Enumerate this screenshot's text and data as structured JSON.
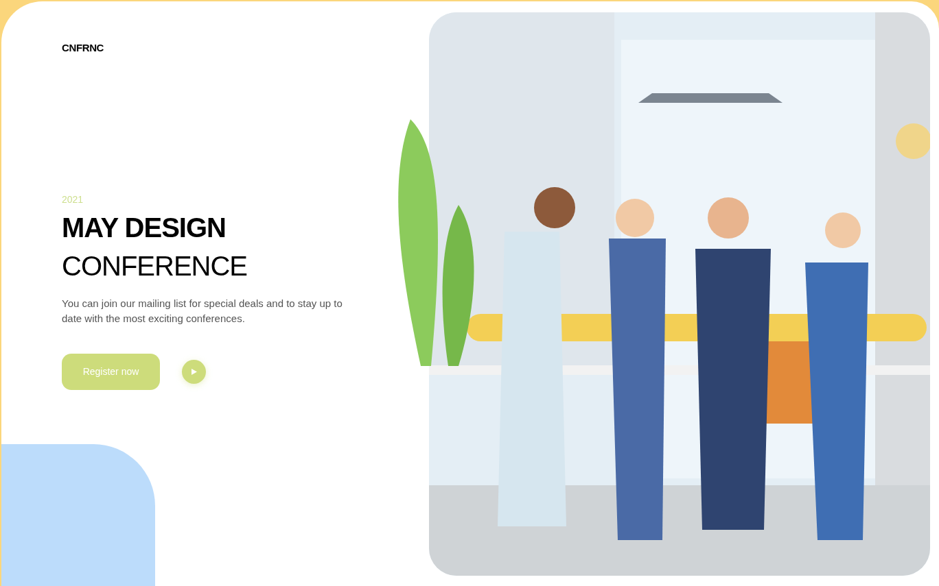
{
  "logo": "CNFRNC",
  "hero": {
    "year": "2021",
    "title_bold": "MAY DESIGN",
    "title_light": "CONFERENCE",
    "description": "You can join our mailing list for special deals and to stay up to date with the most exciting conferences.",
    "register_button": "Register now"
  }
}
